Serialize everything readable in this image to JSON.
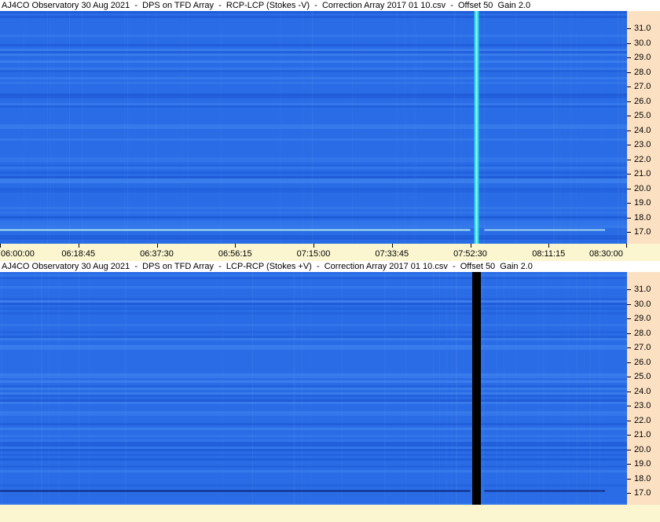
{
  "panels": [
    {
      "title": "AJ4CO Observatory 30 Aug 2021  -  DPS on TFD Array  -  RCP-LCP (Stokes -V)  -  Correction Array 2017 01 10.csv  -  Offset 50  Gain 2.0",
      "event_color": "#29d7e6"
    },
    {
      "title": "AJ4CO Observatory 30 Aug 2021  -  DPS on TFD Array  -  LCP-RCP (Stokes +V)  -  Correction Array 2017 01 10.csv  -  Offset 50  Gain 2.0",
      "event_color": "#000000"
    }
  ],
  "chart_data": {
    "type": "heatmap",
    "x_ticks": [
      "06:00:00",
      "06:18:45",
      "06:37:30",
      "06:56:15",
      "07:15:00",
      "07:33:45",
      "07:52:30",
      "08:11:15",
      "08:30:00"
    ],
    "xlim": [
      "06:00:00",
      "08:30:00"
    ],
    "y_ticks": [
      "17.0",
      "18.0",
      "19.0",
      "20.0",
      "21.0",
      "22.0",
      "23.0",
      "24.0",
      "25.0",
      "26.0",
      "27.0",
      "28.0",
      "29.0",
      "30.0",
      "31.0"
    ],
    "ylim": [
      16.2,
      32.2
    ],
    "event_time": "07:54:00",
    "interference_freq": 17.2,
    "colors": {
      "background": "#2a6ce6",
      "dark_band": "#1c57d4",
      "light_band": "#3f82ee"
    }
  }
}
